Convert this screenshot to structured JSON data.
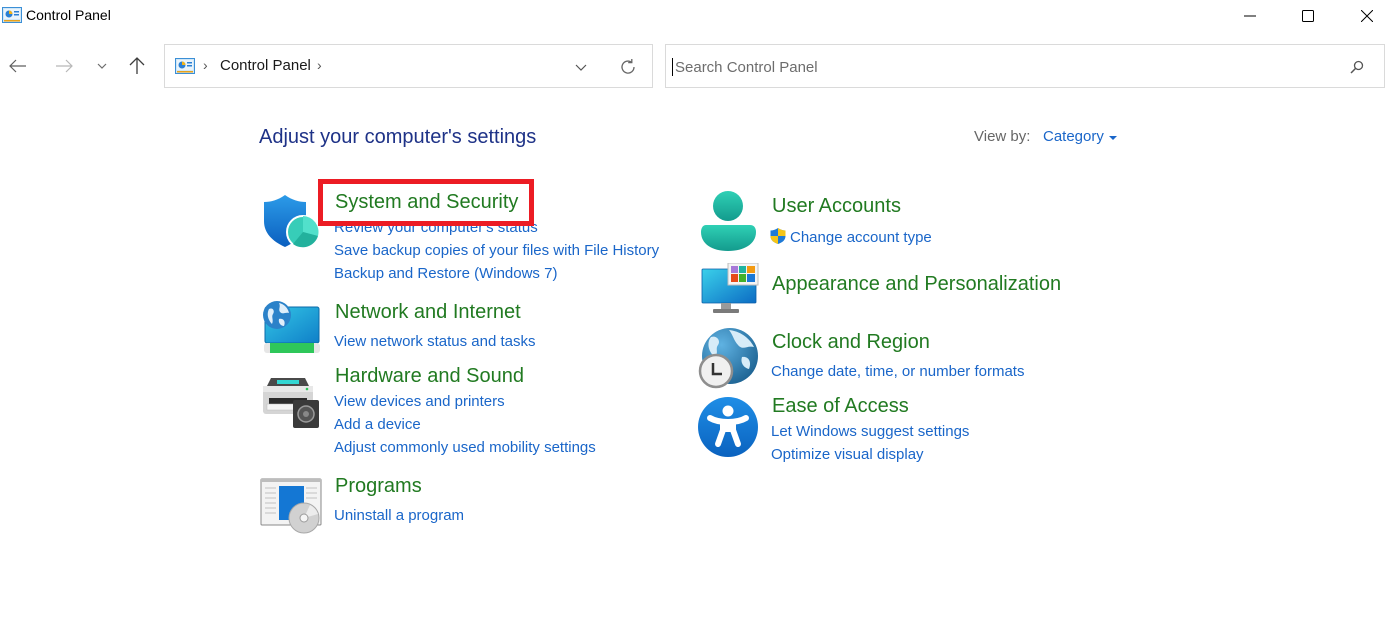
{
  "window": {
    "title": "Control Panel",
    "controls": {
      "minimize": "minimize",
      "maximize": "maximize",
      "close": "close"
    }
  },
  "nav": {
    "back_icon": "arrow-left",
    "forward_icon": "arrow-right",
    "recent_icon": "chevron-down",
    "up_icon": "arrow-up"
  },
  "addressbar": {
    "separator": "›",
    "breadcrumb": [
      "Control Panel"
    ],
    "dropdown_icon": "chevron-down",
    "refresh_icon": "refresh"
  },
  "search": {
    "placeholder": "Search Control Panel",
    "value": "",
    "icon": "search"
  },
  "content": {
    "title": "Adjust your computer's settings",
    "view_by": {
      "label": "View by:",
      "selected": "Category"
    },
    "highlight": {
      "target": "System and Security",
      "color": "#ec1c24"
    },
    "left_column": [
      {
        "title": "System and Security",
        "icon": "shield-icon",
        "links": [
          "Review your computer's status",
          "Save backup copies of your files with File History",
          "Backup and Restore (Windows 7)"
        ]
      },
      {
        "title": "Network and Internet",
        "icon": "network-icon",
        "links": [
          "View network status and tasks"
        ]
      },
      {
        "title": "Hardware and Sound",
        "icon": "printer-speaker-icon",
        "links": [
          "View devices and printers",
          "Add a device",
          "Adjust commonly used mobility settings"
        ]
      },
      {
        "title": "Programs",
        "icon": "programs-disc-icon",
        "links": [
          "Uninstall a program"
        ]
      }
    ],
    "right_column": [
      {
        "title": "User Accounts",
        "icon": "user-icon",
        "links": [
          "Change account type"
        ],
        "link_icons": [
          "uac-shield-icon"
        ]
      },
      {
        "title": "Appearance and Personalization",
        "icon": "monitor-palette-icon",
        "links": []
      },
      {
        "title": "Clock and Region",
        "icon": "globe-clock-icon",
        "links": [
          "Change date, time, or number formats"
        ]
      },
      {
        "title": "Ease of Access",
        "icon": "accessibility-icon",
        "links": [
          "Let Windows suggest settings",
          "Optimize visual display"
        ]
      }
    ]
  },
  "colors": {
    "heading": "#217a21",
    "link": "#1a66c9",
    "page_title": "#1e3287",
    "highlight_box": "#ec1c24"
  }
}
